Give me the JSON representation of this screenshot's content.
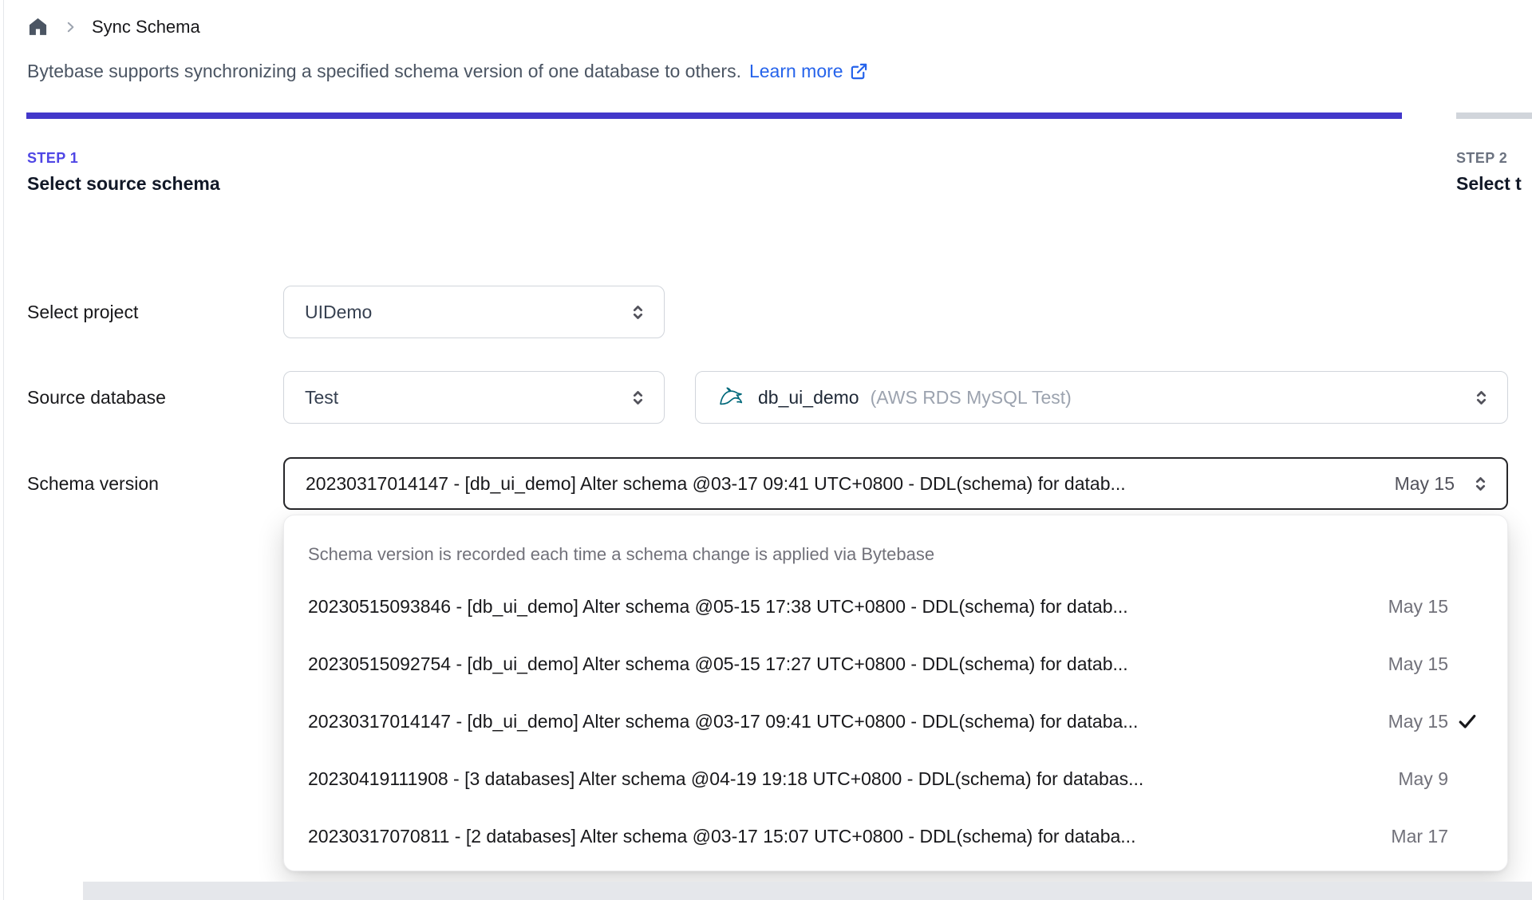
{
  "breadcrumb": {
    "title": "Sync Schema"
  },
  "intro": {
    "text": "Bytebase supports synchronizing a specified schema version of one database to others.",
    "link_label": "Learn more"
  },
  "steps": [
    {
      "label": "STEP 1",
      "title": "Select source schema",
      "state": "active"
    },
    {
      "label": "STEP 2",
      "title": "Select t",
      "state": "upcoming"
    }
  ],
  "form": {
    "project": {
      "label": "Select project",
      "value": "UIDemo"
    },
    "source_database": {
      "label": "Source database",
      "environment_value": "Test",
      "database_value": "db_ui_demo",
      "database_annotation": "(AWS RDS MySQL Test)",
      "database_icon": "mysql-dolphin"
    },
    "schema_version": {
      "label": "Schema version",
      "value": "20230317014147 - [db_ui_demo] Alter schema @03-17 09:41 UTC+0800 - DDL(schema) for datab...",
      "value_date": "May 15"
    }
  },
  "dropdown": {
    "header": "Schema version is recorded each time a schema change is applied via Bytebase",
    "options": [
      {
        "text": "20230515093846 - [db_ui_demo] Alter schema @05-15 17:38 UTC+0800 - DDL(schema) for datab...",
        "date": "May 15",
        "selected": false
      },
      {
        "text": "20230515092754 - [db_ui_demo] Alter schema @05-15 17:27 UTC+0800 - DDL(schema) for datab...",
        "date": "May 15",
        "selected": false
      },
      {
        "text": "20230317014147 - [db_ui_demo] Alter schema @03-17 09:41 UTC+0800 - DDL(schema) for databa...",
        "date": "May 15",
        "selected": true
      },
      {
        "text": "20230419111908 - [3 databases] Alter schema @04-19 19:18 UTC+0800 - DDL(schema) for databas...",
        "date": "May 9",
        "selected": false
      },
      {
        "text": "20230317070811 - [2 databases] Alter schema @03-17 15:07 UTC+0800 - DDL(schema) for databa...",
        "date": "Mar 17",
        "selected": false
      }
    ]
  },
  "colors": {
    "progress_active": "#4338ca",
    "progress_upcoming": "#d1d5db",
    "step_active": "#4f46e5",
    "link": "#2563eb",
    "focused_select_border": "#27272a",
    "mysql_icon_teal": "#00687a"
  }
}
